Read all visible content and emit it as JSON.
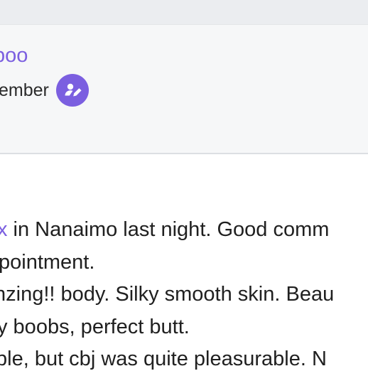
{
  "profile": {
    "username_visible": "boo",
    "member_label_visible": "ember",
    "badge_icon": "user-edit-icon",
    "accent_color": "#7b5fe0"
  },
  "post": {
    "line1": {
      "link_fragment": "x",
      "text": " in Nanaimo last night. Good comm"
    },
    "line2": "pointment.",
    "line3": "nzing!! body. Silky smooth skin. Beau",
    "line4": "y boobs, perfect butt.",
    "line5": "ble, but cbj was quite pleasurable. N"
  }
}
